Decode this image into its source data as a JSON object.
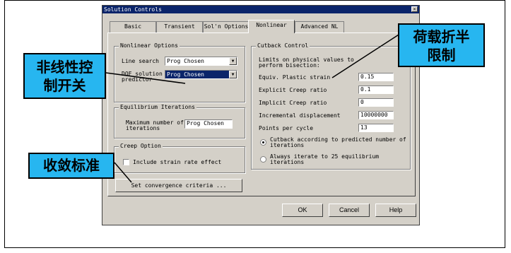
{
  "dialog": {
    "title": "Solution Controls",
    "close_glyph": "×",
    "tabs": [
      {
        "label": "Basic",
        "active": false
      },
      {
        "label": "Transient",
        "active": false
      },
      {
        "label": "Sol'n Options",
        "active": false
      },
      {
        "label": "Nonlinear",
        "active": true
      },
      {
        "label": "Advanced NL",
        "active": false
      }
    ],
    "nonlinear_options": {
      "title": "Nonlinear Options",
      "line_search_label": "Line search",
      "line_search_value": "Prog Chosen",
      "dof_label_1": "DOF solution",
      "dof_label_2": "predictor",
      "dof_value": "Prog Chosen"
    },
    "equilibrium": {
      "title": "Equilibrium Iterations",
      "max_label_1": "Maximum number of",
      "max_label_2": "iterations",
      "max_value": "Prog Chosen"
    },
    "creep": {
      "title": "Creep Option",
      "strain_rate_label": "Include strain rate effect"
    },
    "convergence_button": "Set convergence criteria ...",
    "cutback": {
      "title": "Cutback Control",
      "limits_1": "Limits on physical values to",
      "limits_2": "perform bisection:",
      "plastic_label": "Equiv. Plastic strain",
      "plastic_value": "0.15",
      "explicit_label": "Explicit Creep ratio",
      "explicit_value": "0.1",
      "implicit_label": "Implicit Creep ratio",
      "implicit_value": "0",
      "incr_label": "Incremental displacement",
      "incr_value": "10000000",
      "points_label": "Points per cycle",
      "points_value": "13",
      "radio1_1": "Cutback according to predicted number of",
      "radio1_2": "iterations",
      "radio2_1": "Always iterate to 25 equilibrium",
      "radio2_2": "iterations"
    },
    "ok": "OK",
    "cancel": "Cancel",
    "help": "Help"
  },
  "callouts": {
    "switch": [
      "非线性控",
      "制开关"
    ],
    "cutback": [
      "荷载折半",
      "限制"
    ],
    "convergence": "收敛标准"
  },
  "colors": {
    "callout_blue": "#27b6f0",
    "dialog_face": "#d4d0c8",
    "titlebar": "#0a246a"
  }
}
